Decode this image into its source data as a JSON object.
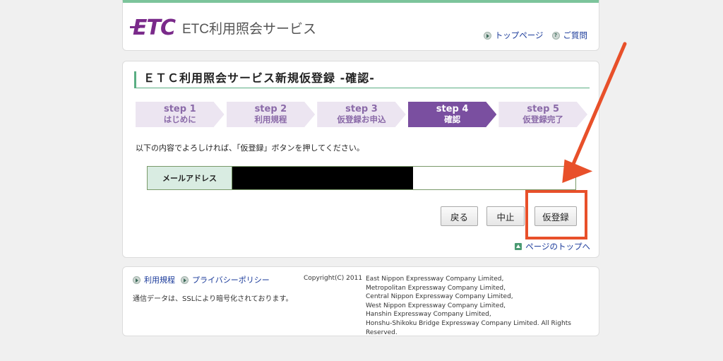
{
  "header": {
    "logo_mark": "ETC",
    "logo_text": "ETC利用照会サービス",
    "links": [
      {
        "label": "トップページ",
        "icon": "play-circle-icon"
      },
      {
        "label": "ご質問",
        "icon": "question-circle-icon"
      }
    ]
  },
  "main": {
    "title": "ＥＴＣ利用照会サービス新規仮登録 -確認-",
    "steps": [
      {
        "num": "step 1",
        "name": "はじめに",
        "active": false
      },
      {
        "num": "step 2",
        "name": "利用規程",
        "active": false
      },
      {
        "num": "step 3",
        "name": "仮登録お申込",
        "active": false
      },
      {
        "num": "step 4",
        "name": "確認",
        "active": true
      },
      {
        "num": "step 5",
        "name": "仮登録完了",
        "active": false
      }
    ],
    "instruction": "以下の内容でよろしければ、「仮登録」ボタンを押してください。",
    "email_label": "メールアドレス",
    "email_value": "",
    "buttons": {
      "back": "戻る",
      "cancel": "中止",
      "register": "仮登録"
    },
    "page_top": "ページのトップへ"
  },
  "footer": {
    "links": [
      "利用規程",
      "プライバシーポリシー"
    ],
    "ssl_note": "通信データは、SSLにより暗号化されております。",
    "copyright": "Copyright(C) 2011",
    "companies": [
      "East Nippon Expressway Company Limited,",
      "Metropolitan Expressway Company Limited,",
      "Central Nippon Expressway Company Limited,",
      "West Nippon Expressway Company Limited,",
      "Hanshin Expressway Company Limited,",
      "Honshu-Shikoku Bridge Expressway Company Limited. All Rights Reserved."
    ]
  },
  "colors": {
    "accent_green": "#7cc49b",
    "brand_purple": "#7a2a8a",
    "active_step": "#7a4fa0",
    "annotation_red": "#e8502a"
  }
}
